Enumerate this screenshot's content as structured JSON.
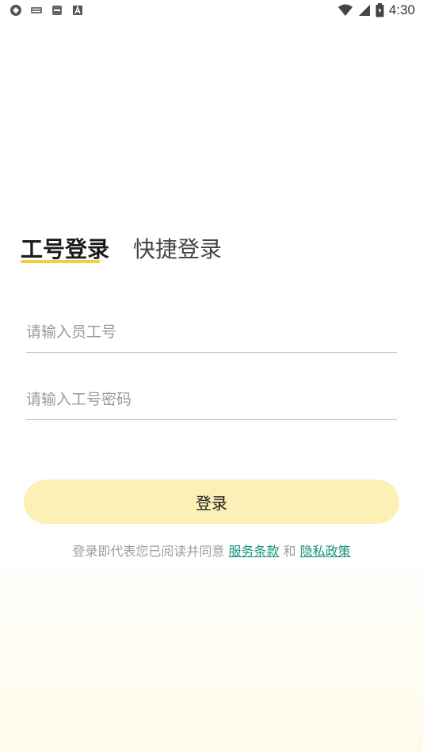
{
  "status_bar": {
    "time": "4:30",
    "left_icons": [
      "app-icon",
      "keyboard-icon",
      "sim-icon",
      "a-icon"
    ],
    "right_icons": [
      "wifi-icon",
      "signal-icon",
      "battery-icon"
    ]
  },
  "tabs": [
    {
      "label": "工号登录",
      "active": true
    },
    {
      "label": "快捷登录",
      "active": false
    }
  ],
  "form": {
    "id_placeholder": "请输入员工号",
    "password_placeholder": "请输入工号密码",
    "login_label": "登录"
  },
  "agreement": {
    "prefix": "登录即代表您已阅读并同意",
    "terms_link": "服务条款",
    "conjunction": "和",
    "privacy_link": "隐私政策"
  },
  "colors": {
    "accent_yellow": "#f4cf3a",
    "button_bg": "#fdf0b6",
    "link": "#15937a"
  }
}
